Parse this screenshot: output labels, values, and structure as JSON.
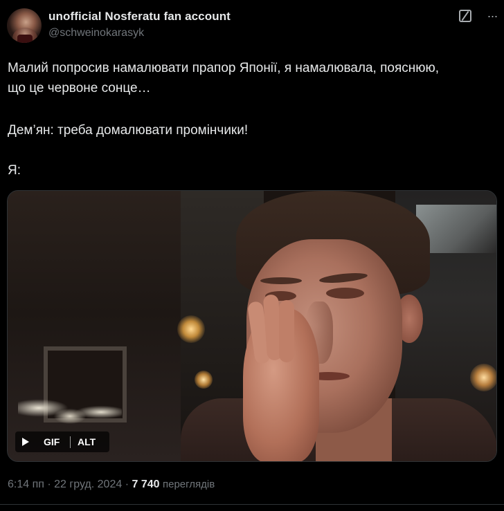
{
  "author": {
    "name": "unofficial Nosferatu fan account",
    "handle": "@schweinokarasyk"
  },
  "header_icons": {
    "grok": "grok-icon",
    "more": "···"
  },
  "tweet": {
    "lines": [
      "Малий попросив намалювати прапор Японії, я намалювала, пояснюю,",
      "що це червоне сонце…",
      "Дем’ян: треба домалювати промінчики!",
      "Я:"
    ]
  },
  "media": {
    "type": "gif",
    "gif_label": "GIF",
    "alt_label": "ALT",
    "play_icon": "play-icon"
  },
  "meta": {
    "time": "6:14 пп",
    "date": "22 груд. 2024",
    "separator": "·",
    "views_count": "7 740",
    "views_label": "переглядів"
  },
  "colors": {
    "background": "#000000",
    "primary_text": "#e7e9ea",
    "secondary_text": "#71767b",
    "border": "#2f3336"
  }
}
